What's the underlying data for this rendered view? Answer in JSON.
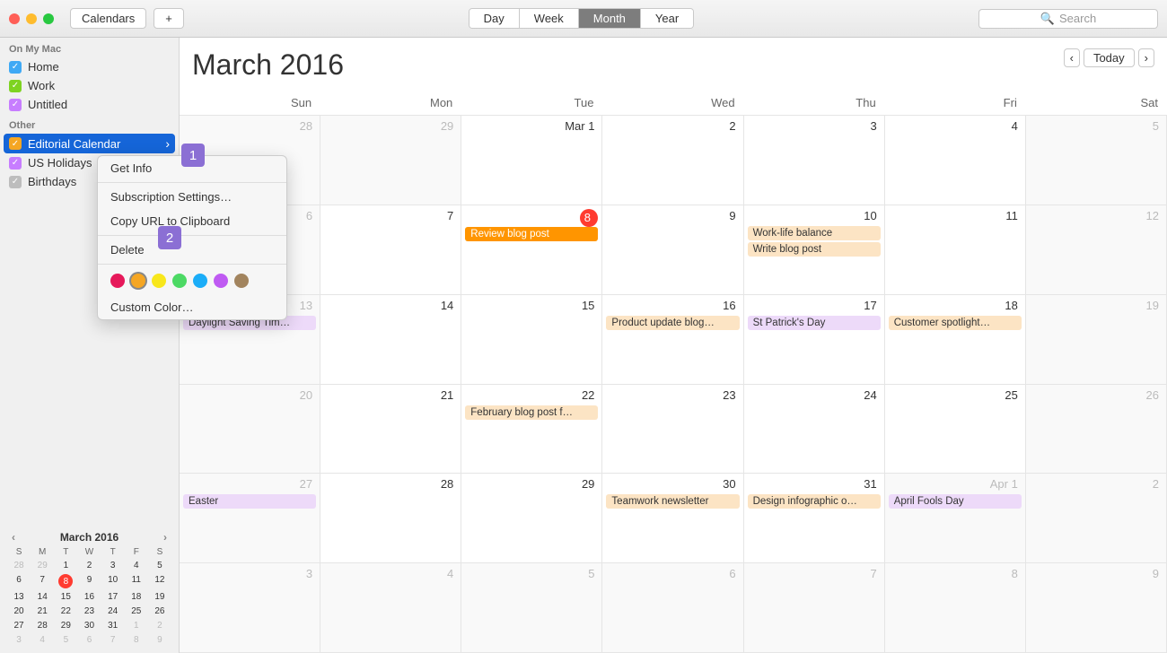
{
  "toolbar": {
    "calendars_label": "Calendars",
    "plus": "+",
    "views": [
      "Day",
      "Week",
      "Month",
      "Year"
    ],
    "active_view": "Month",
    "search_placeholder": "Search"
  },
  "sidebar": {
    "sections": [
      {
        "title": "On My Mac",
        "items": [
          {
            "label": "Home",
            "color": "#3fa9f5",
            "checked": true
          },
          {
            "label": "Work",
            "color": "#7ed321",
            "checked": true
          },
          {
            "label": "Untitled",
            "color": "#c77dff",
            "checked": true
          }
        ]
      },
      {
        "title": "Other",
        "items": [
          {
            "label": "Editorial Calendar",
            "color": "#f5a623",
            "checked": true,
            "selected": true
          },
          {
            "label": "US Holidays",
            "color": "#c77dff",
            "checked": true
          },
          {
            "label": "Birthdays",
            "color": "#bdbdbd",
            "checked": true
          }
        ]
      }
    ]
  },
  "context_menu": {
    "items": [
      "Get Info",
      "Subscription Settings…",
      "Copy URL to Clipboard",
      "Delete"
    ],
    "colors": [
      "#e6195a",
      "#f5a623",
      "#f8e71c",
      "#4cd964",
      "#1badf8",
      "#bf5af2",
      "#a2845e"
    ],
    "selected_color_index": 1,
    "custom_color_label": "Custom Color…"
  },
  "annotations": [
    "1",
    "2"
  ],
  "header": {
    "month": "March",
    "year": "2016",
    "today_label": "Today"
  },
  "dow": [
    "Sun",
    "Mon",
    "Tue",
    "Wed",
    "Thu",
    "Fri",
    "Sat"
  ],
  "cells": [
    [
      {
        "t": "28",
        "off": true
      },
      {
        "t": "29",
        "off": true
      },
      {
        "t": "Mar 1"
      },
      {
        "t": "2"
      },
      {
        "t": "3"
      },
      {
        "t": "4"
      },
      {
        "t": "5",
        "off": true
      }
    ],
    [
      {
        "t": "6",
        "off": true
      },
      {
        "t": "7"
      },
      {
        "t": "8",
        "today": true,
        "events": [
          {
            "t": "Review blog post",
            "bg": "#ff9500",
            "fg": "#fff"
          }
        ]
      },
      {
        "t": "9"
      },
      {
        "t": "10",
        "events": [
          {
            "t": "Work-life balance",
            "bg": "#fce4c4"
          },
          {
            "t": "Write blog post",
            "bg": "#fce4c4"
          }
        ]
      },
      {
        "t": "11"
      },
      {
        "t": "12",
        "off": true
      }
    ],
    [
      {
        "t": "13",
        "off": true,
        "events": [
          {
            "t": "Daylight Saving Tim…",
            "bg": "#eddaf9"
          }
        ]
      },
      {
        "t": "14"
      },
      {
        "t": "15"
      },
      {
        "t": "16",
        "events": [
          {
            "t": "Product update blog…",
            "bg": "#fce4c4"
          }
        ]
      },
      {
        "t": "17",
        "events": [
          {
            "t": "St Patrick's Day",
            "bg": "#eddaf9"
          }
        ]
      },
      {
        "t": "18",
        "events": [
          {
            "t": "Customer spotlight…",
            "bg": "#fce4c4"
          }
        ]
      },
      {
        "t": "19",
        "off": true
      }
    ],
    [
      {
        "t": "20",
        "off": true
      },
      {
        "t": "21"
      },
      {
        "t": "22",
        "events": [
          {
            "t": "February blog post f…",
            "bg": "#fce4c4"
          }
        ]
      },
      {
        "t": "23"
      },
      {
        "t": "24"
      },
      {
        "t": "25"
      },
      {
        "t": "26",
        "off": true
      }
    ],
    [
      {
        "t": "27",
        "off": true,
        "events": [
          {
            "t": "Easter",
            "bg": "#eddaf9"
          }
        ]
      },
      {
        "t": "28"
      },
      {
        "t": "29"
      },
      {
        "t": "30",
        "events": [
          {
            "t": "Teamwork newsletter",
            "bg": "#fce4c4"
          }
        ]
      },
      {
        "t": "31",
        "events": [
          {
            "t": "Design infographic o…",
            "bg": "#fce4c4"
          }
        ]
      },
      {
        "t": "Apr 1",
        "off": true,
        "events": [
          {
            "t": "April Fools Day",
            "bg": "#eddaf9"
          }
        ]
      },
      {
        "t": "2",
        "off": true
      }
    ],
    [
      {
        "t": "3",
        "off": true
      },
      {
        "t": "4",
        "off": true
      },
      {
        "t": "5",
        "off": true
      },
      {
        "t": "6",
        "off": true
      },
      {
        "t": "7",
        "off": true
      },
      {
        "t": "8",
        "off": true
      },
      {
        "t": "9",
        "off": true
      }
    ]
  ],
  "mini": {
    "title": "March 2016",
    "dow": [
      "S",
      "M",
      "T",
      "W",
      "T",
      "F",
      "S"
    ],
    "rows": [
      [
        "28",
        "29",
        "1",
        "2",
        "3",
        "4",
        "5"
      ],
      [
        "6",
        "7",
        "8",
        "9",
        "10",
        "11",
        "12"
      ],
      [
        "13",
        "14",
        "15",
        "16",
        "17",
        "18",
        "19"
      ],
      [
        "20",
        "21",
        "22",
        "23",
        "24",
        "25",
        "26"
      ],
      [
        "27",
        "28",
        "29",
        "30",
        "31",
        "1",
        "2"
      ],
      [
        "3",
        "4",
        "5",
        "6",
        "7",
        "8",
        "9"
      ]
    ],
    "off_first": [
      0,
      1
    ],
    "off_last_row5": [
      5,
      6
    ],
    "today": "8"
  }
}
